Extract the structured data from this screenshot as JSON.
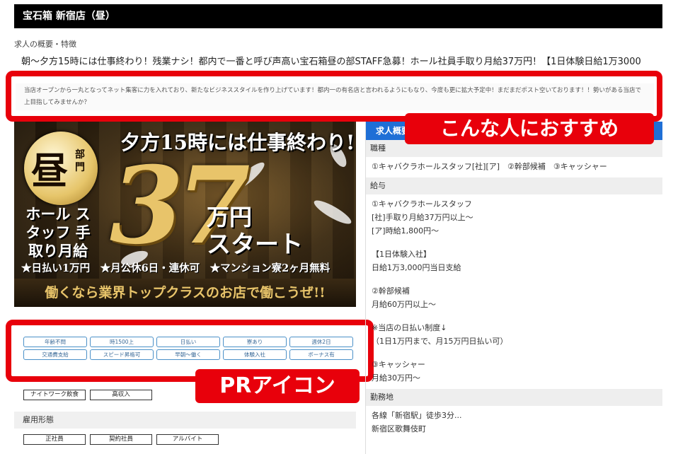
{
  "header": {
    "title": "宝石箱 新宿店（昼）"
  },
  "overview": {
    "label": "求人の概要・特徴",
    "catchcopy": "朝〜夕方15時には仕事終わり！残業ナシ！都内で一番と呼び声高い宝石箱昼の部STAFF急募！ホール社員手取り月給37万円！【1日体験日給1万3000"
  },
  "description": "当店オープンから一丸となってネット集客に力を入れており、新たなビジネススタイルを作り上げています！都内一の有名店と言われるようにもなり、今度も更に拡大予定中！まだまだポスト空いております！！勢いがある当店で上目指してみませんか？",
  "callouts": {
    "recommend": "こんな人におすすめ",
    "pr_icon": "PRアイコン"
  },
  "banner": {
    "seal_big": "昼",
    "seal_small": "部門",
    "top_line": "夕方15時には仕事終わり!!",
    "big_number": "37",
    "unit": "万円",
    "start": "スタート",
    "left_text": "ホール スタッフ 手取り月給",
    "bullets": "★日払い1万円　★月公休6日・連休可　★マンション寮2ヶ月無料",
    "bottom": "働くなら業界トップクラスのお店で働こうぜ!!"
  },
  "pr_tags": [
    "年齢不問",
    "時1500上",
    "日払い",
    "寮あり",
    "週休2日",
    "交通費支給",
    "スピード昇格可",
    "早朝〜働く",
    "体験入社",
    "ボーナス有"
  ],
  "categories": [
    "ナイトワーク飲食",
    "高収入"
  ],
  "employment": {
    "heading": "雇用形態",
    "types": [
      "正社員",
      "契約社員",
      "アルバイト"
    ]
  },
  "summary": {
    "title": "求人概要",
    "sections": [
      {
        "heading": "職種",
        "lines": [
          "①キャバクラホールスタッフ[社][ア]　②幹部候補　③キャッシャー"
        ]
      },
      {
        "heading": "給与",
        "lines": [
          "①キャバクラホールスタッフ",
          "[社]手取り月給37万円以上〜",
          "[ア]時給1,800円〜",
          "",
          "【1日体験入社】",
          "日給1万3,000円当日支給",
          "",
          "②幹部候補",
          "月給60万円以上〜",
          "",
          "※当店の日払い制度↓",
          "（1日1万円まで、月15万円日払い可）",
          "",
          "③キャッシャー",
          "月給30万円〜"
        ]
      },
      {
        "heading": "勤務地",
        "lines": [
          "各線「新宿駅」徒歩3分...",
          "新宿区歌舞伎町"
        ]
      }
    ]
  },
  "colors": {
    "accent_red": "#e8000b",
    "header_bg": "#000000",
    "summary_blue": "#1f6fd6",
    "tag_border": "#4a90c8"
  }
}
